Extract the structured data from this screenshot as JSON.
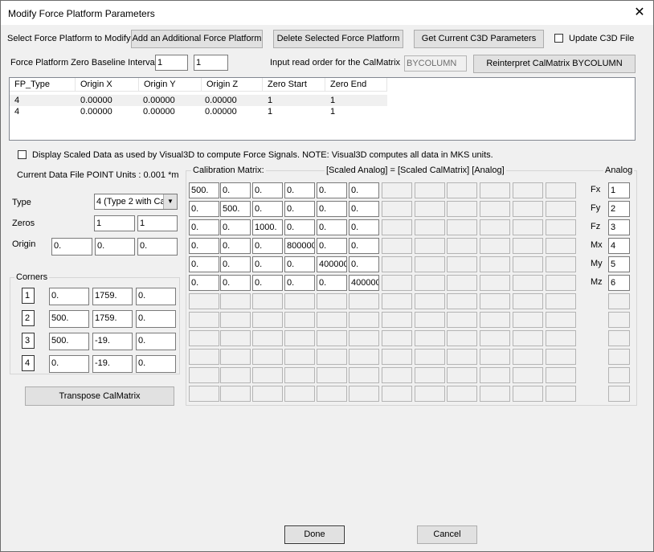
{
  "window": {
    "title": "Modify Force Platform Parameters",
    "close_glyph": "✕"
  },
  "top": {
    "select_label": "Select Force Platform to Modify",
    "add_button": "Add an Additional Force Platform",
    "delete_button": "Delete Selected Force Platform",
    "get_params_button": "Get Current C3D Parameters",
    "update_c3d_label": "Update C3D File",
    "update_c3d_checked": false,
    "zero_baseline_label": "Force Platform Zero Baseline Interval",
    "zero_baseline_start": "1",
    "zero_baseline_end": "1",
    "read_order_label": "Input read order for the CalMatrix",
    "read_order_value": "BYCOLUMN",
    "reinterpret_button": "Reinterpret CalMatrix BYCOLUMN"
  },
  "platform_list": {
    "headers": [
      "FP_Type",
      "Origin X",
      "Origin Y",
      "Origin Z",
      "Zero Start",
      "Zero End"
    ],
    "rows": [
      [
        "4",
        "0.00000",
        "0.00000",
        "0.00000",
        "1",
        "1"
      ],
      [
        "4",
        "0.00000",
        "0.00000",
        "0.00000",
        "1",
        "1"
      ]
    ]
  },
  "scaled_checkbox": {
    "label": "Display Scaled Data as used by Visual3D to compute Force Signals. NOTE: Visual3D computes all data in MKS units.",
    "checked": false
  },
  "left": {
    "point_units": "Current Data File POINT Units : 0.001 *m",
    "type_label": "Type",
    "type_value": "4  (Type 2 with Ca",
    "zeros_label": "Zeros",
    "zeros": [
      "1",
      "1"
    ],
    "origin_label": "Origin",
    "origin": [
      "0.",
      "0.",
      "0."
    ],
    "corners_label": "Corners",
    "corners": [
      {
        "index": "1",
        "x": "0.",
        "y": "1759.",
        "z": "0."
      },
      {
        "index": "2",
        "x": "500.",
        "y": "1759.",
        "z": "0."
      },
      {
        "index": "3",
        "x": "500.",
        "y": "-19.",
        "z": "0."
      },
      {
        "index": "4",
        "x": "0.",
        "y": "-19.",
        "z": "0."
      }
    ],
    "transpose_button": "Transpose CalMatrix"
  },
  "calibration": {
    "label": "Calibration Matrix:",
    "formula": "[Scaled Analog] = [Scaled CalMatrix] [Analog]",
    "analog_label": "Analog",
    "matrix": [
      [
        "500.",
        "0.",
        "0.",
        "0.",
        "0.",
        "0."
      ],
      [
        "0.",
        "500.",
        "0.",
        "0.",
        "0.",
        "0."
      ],
      [
        "0.",
        "0.",
        "1000.",
        "0.",
        "0.",
        "0."
      ],
      [
        "0.",
        "0.",
        "0.",
        "800000",
        "0.",
        "0."
      ],
      [
        "0.",
        "0.",
        "0.",
        "0.",
        "400000",
        "0."
      ],
      [
        "0.",
        "0.",
        "0.",
        "0.",
        "0.",
        "400000"
      ]
    ],
    "analog_channels": [
      {
        "label": "Fx",
        "value": "1"
      },
      {
        "label": "Fy",
        "value": "2"
      },
      {
        "label": "Fz",
        "value": "3"
      },
      {
        "label": "Mx",
        "value": "4"
      },
      {
        "label": "My",
        "value": "5"
      },
      {
        "label": "Mz",
        "value": "6"
      }
    ]
  },
  "footer": {
    "done": "Done",
    "cancel": "Cancel"
  }
}
